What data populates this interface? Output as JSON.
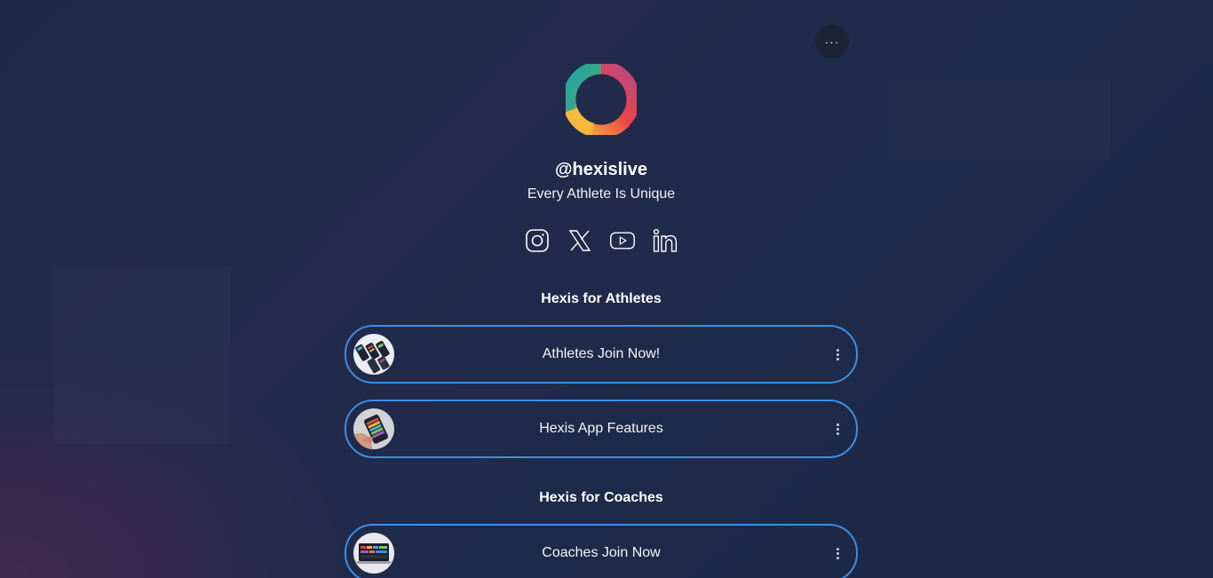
{
  "menu": {
    "icon": "ellipsis-icon",
    "label": "···"
  },
  "profile": {
    "handle": "@hexislive",
    "bio": "Every Athlete Is Unique",
    "logo_icon": "hexis-ring-logo"
  },
  "socials": [
    {
      "icon": "instagram-icon"
    },
    {
      "icon": "x-twitter-icon"
    },
    {
      "icon": "youtube-icon"
    },
    {
      "icon": "linkedin-icon"
    }
  ],
  "sections": [
    {
      "title": "Hexis for Athletes",
      "links": [
        {
          "label": "Athletes Join Now!",
          "thumb": "phones-stack-image"
        },
        {
          "label": "Hexis App Features",
          "thumb": "hand-phone-image"
        }
      ]
    },
    {
      "title": "Hexis for Coaches",
      "links": [
        {
          "label": "Coaches Join Now",
          "thumb": "laptop-dashboard-image"
        }
      ]
    }
  ],
  "colors": {
    "link_border": "#3a8ee6",
    "background": "#222a4a"
  }
}
